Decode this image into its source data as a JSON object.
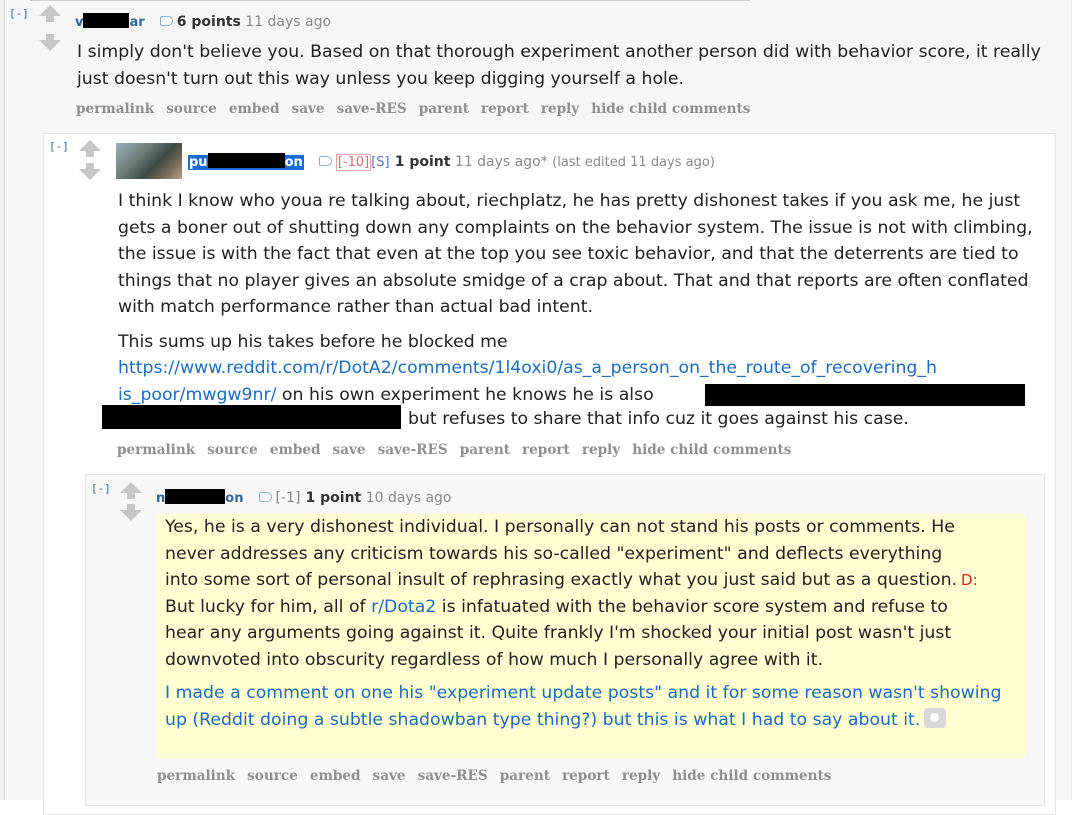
{
  "comments": [
    {
      "toggle": "[-]",
      "username_start": "v",
      "username_end": "ar",
      "points": "6 points",
      "time": "11 days ago",
      "body": "I simply don't believe you. Based on that thorough experiment another person did with behavior score, it really just doesn't turn out this way unless you keep digging yourself a hole."
    },
    {
      "toggle": "[-]",
      "username_start": "pu",
      "username_end": "on",
      "flair": "[-10]",
      "badge": "[S]",
      "points": "1 point",
      "time": "11 days ago*",
      "edited": "(last edited 11 days ago)",
      "body_para1": "I think I know who youa re talking about, riechplatz, he has pretty dishonest takes if you ask me, he just gets a boner out of shutting down any complaints on the behavior system. The issue is not with climbing, the issue is with the fact that even at the top you see toxic behavior, and that the deterrents are tied to things that no player gives an absolute smidge of a crap about. That and that reports are often conflated with match performance rather than actual bad intent.",
      "body_para2_prefix": "This sums up his takes before he blocked me",
      "link_line1": "https://www.reddit.com/r/DotA2/comments/1l4oxi0/as_a_person_on_the_route_of_recovering_h",
      "link_line2": "is_poor/mwgw9nr/",
      "after_link": " on his own experiment he knows he is also",
      "final_text": "but refuses to share that info cuz it goes against his case."
    },
    {
      "toggle": "[-]",
      "username_start": "n",
      "username_end": "on",
      "flair": "[-1]",
      "points": "1 point",
      "time": "10 days ago",
      "body_line1": "Yes, he is a very dishonest individual. I personally can not stand his posts or comments. He",
      "body_line2": "never addresses any criticism towards his so-called \"experiment\" and deflects everything",
      "body_line3": "into some sort of personal insult of rephrasing exactly what you just said but as a question.",
      "emote": "D:",
      "body_line4_prefix": "But lucky for him, all of ",
      "subreddit_link": "r/Dota2",
      "body_line4_suffix": " is infatuated with the behavior score system and refuse to",
      "body_line5": "hear any arguments going against it. Quite frankly I'm shocked your initial post wasn't just",
      "body_line6": "downvoted into obscurity regardless of how much I personally agree with it.",
      "link_para": "I made a comment on one his \"experiment update posts\" and it for some reason wasn't showing up (Reddit doing a subtle shadowban type thing?) but this is what I had to say about it."
    }
  ],
  "actions": {
    "permalink": "permalink",
    "source": "source",
    "embed": "embed",
    "save": "save",
    "save_res": "save-RES",
    "parent": "parent",
    "report": "report",
    "reply": "reply",
    "hide_child": "hide child comments"
  },
  "icons": [
    "upvote-arrow-icon",
    "downvote-arrow-icon",
    "tag-icon",
    "camera-icon"
  ],
  "colors": {
    "link": "#1a6dbf",
    "username": "#369",
    "flair": "#e06b6b",
    "highlight": "#ffffd2"
  }
}
